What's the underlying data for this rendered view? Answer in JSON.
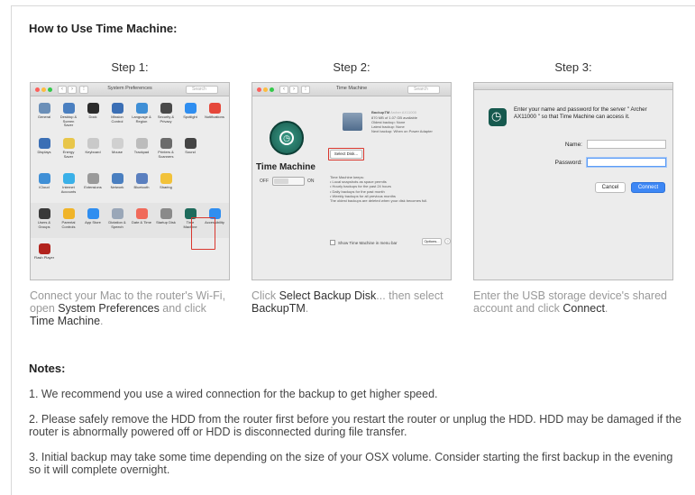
{
  "page": {
    "title": "How to Use Time Machine:"
  },
  "steps": [
    {
      "label": "Step 1:",
      "caption_parts": [
        "Connect your Mac to the router's Wi-Fi, open ",
        "System Preferences",
        " and click ",
        "Time Machine",
        "."
      ]
    },
    {
      "label": "Step 2:",
      "caption_parts": [
        "Click ",
        "Select Backup Disk",
        "... then select ",
        "BackupTM",
        "."
      ]
    },
    {
      "label": "Step 3:",
      "caption_parts": [
        "Enter the USB storage device's shared account and click ",
        "Connect",
        "."
      ]
    }
  ],
  "sysprefs": {
    "window_title": "System Preferences",
    "search_placeholder": "Search",
    "rows": [
      [
        "General",
        "Desktop & Screen Saver",
        "Dock",
        "Mission Control",
        "Language & Region",
        "Security & Privacy",
        "Spotlight",
        "Notifications"
      ],
      [
        "Displays",
        "Energy Saver",
        "Keyboard",
        "Mouse",
        "Trackpad",
        "Printers & Scanners",
        "Sound"
      ],
      [
        "iCloud",
        "Internet Accounts",
        "Extensions",
        "Network",
        "Bluetooth",
        "Sharing"
      ],
      [
        "Users & Groups",
        "Parental Controls",
        "App Store",
        "Dictation & Speech",
        "Date & Time",
        "Startup Disk",
        "Time Machine",
        "Accessibility"
      ],
      [
        "Flash Player"
      ]
    ],
    "icon_colors": [
      [
        "#6b8fb8",
        "#4a7fc0",
        "#2b2b2b",
        "#3b6fb5",
        "#3f8fd6",
        "#4a4a4a",
        "#2f8ef0",
        "#e5473a"
      ],
      [
        "#3b6fb5",
        "#e8c64a",
        "#c9c9c9",
        "#d0d0d0",
        "#bcbcbc",
        "#6b6b6b",
        "#444444"
      ],
      [
        "#3f8fd6",
        "#3ab0e8",
        "#9a9a9a",
        "#4a7fc0",
        "#5a7fbf",
        "#f2c23a"
      ],
      [
        "#3a3a3a",
        "#f0b429",
        "#2f8ef0",
        "#9aa7b8",
        "#f06a5a",
        "#8a8a8a",
        "#1e6b5c",
        "#2f8ef0"
      ],
      [
        "#b2231d"
      ]
    ]
  },
  "timemachine": {
    "window_title": "Time Machine",
    "search_placeholder": "Search",
    "app_name": "Time Machine",
    "off_label": "OFF",
    "on_label": "ON",
    "disk_name": "BackupTM",
    "disk_sub": "Archer AX11000",
    "disk_details": [
      "870 MB of 1.07 GB available",
      "Oldest backup: None",
      "Latest backup: None",
      "Next backup: When on Power Adapter"
    ],
    "select_disk_label": "Select Disk...",
    "keeps_title": "Time Machine keeps:",
    "keeps": [
      "• Local snapshots as space permits",
      "• Hourly backups for the past 24 hours",
      "• Daily backups for the past month",
      "• Weekly backups for all previous months"
    ],
    "keeps_note": "The oldest backups are deleted when your disk becomes full.",
    "menubar_label": "Show Time Machine in menu bar",
    "options_label": "Options...",
    "help_label": "?"
  },
  "login": {
    "prompt": "Enter your name and password for the server \" Archer AX11000 \" so that Time Machine can access it.",
    "name_label": "Name:",
    "password_label": "Password:",
    "cancel_label": "Cancel",
    "connect_label": "Connect"
  },
  "notes": {
    "title": "Notes:",
    "items": [
      "1. We recommend you use a wired connection for the backup to get higher speed.",
      "2. Please safely remove the HDD from the router first before you restart the router or unplug the HDD. HDD may be damaged if the router is abnormally powered off or HDD is disconnected during file transfer.",
      "3. Initial backup may take some time depending on the size of your OSX volume. Consider starting the first backup in the evening so it will complete overnight."
    ]
  }
}
